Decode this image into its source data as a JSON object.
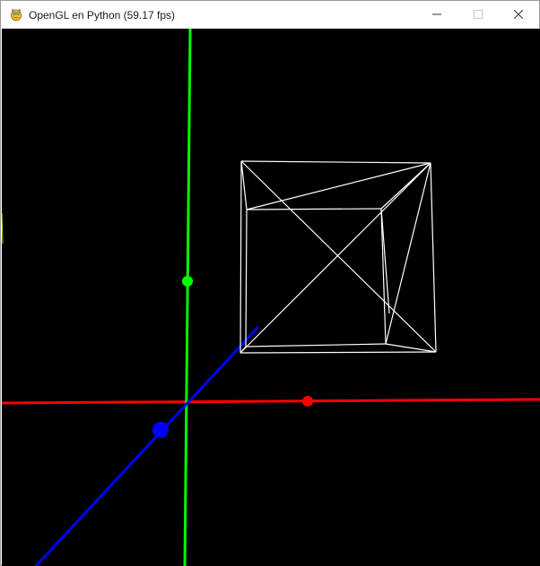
{
  "window": {
    "title": "OpenGL en Python (59.17 fps)",
    "app_icon": "pygame-snake-icon",
    "controls": {
      "minimize_icon": "minimize-icon",
      "maximize_icon": "maximize-icon",
      "close_icon": "close-icon"
    }
  },
  "scene": {
    "background_color": "#000000",
    "axes": [
      {
        "name": "x-axis",
        "color": "#ff0000"
      },
      {
        "name": "y-axis",
        "color": "#00ff00"
      },
      {
        "name": "z-axis",
        "color": "#0000ff"
      }
    ],
    "wireframe": {
      "shape": "cube",
      "color": "#ffffff"
    }
  }
}
